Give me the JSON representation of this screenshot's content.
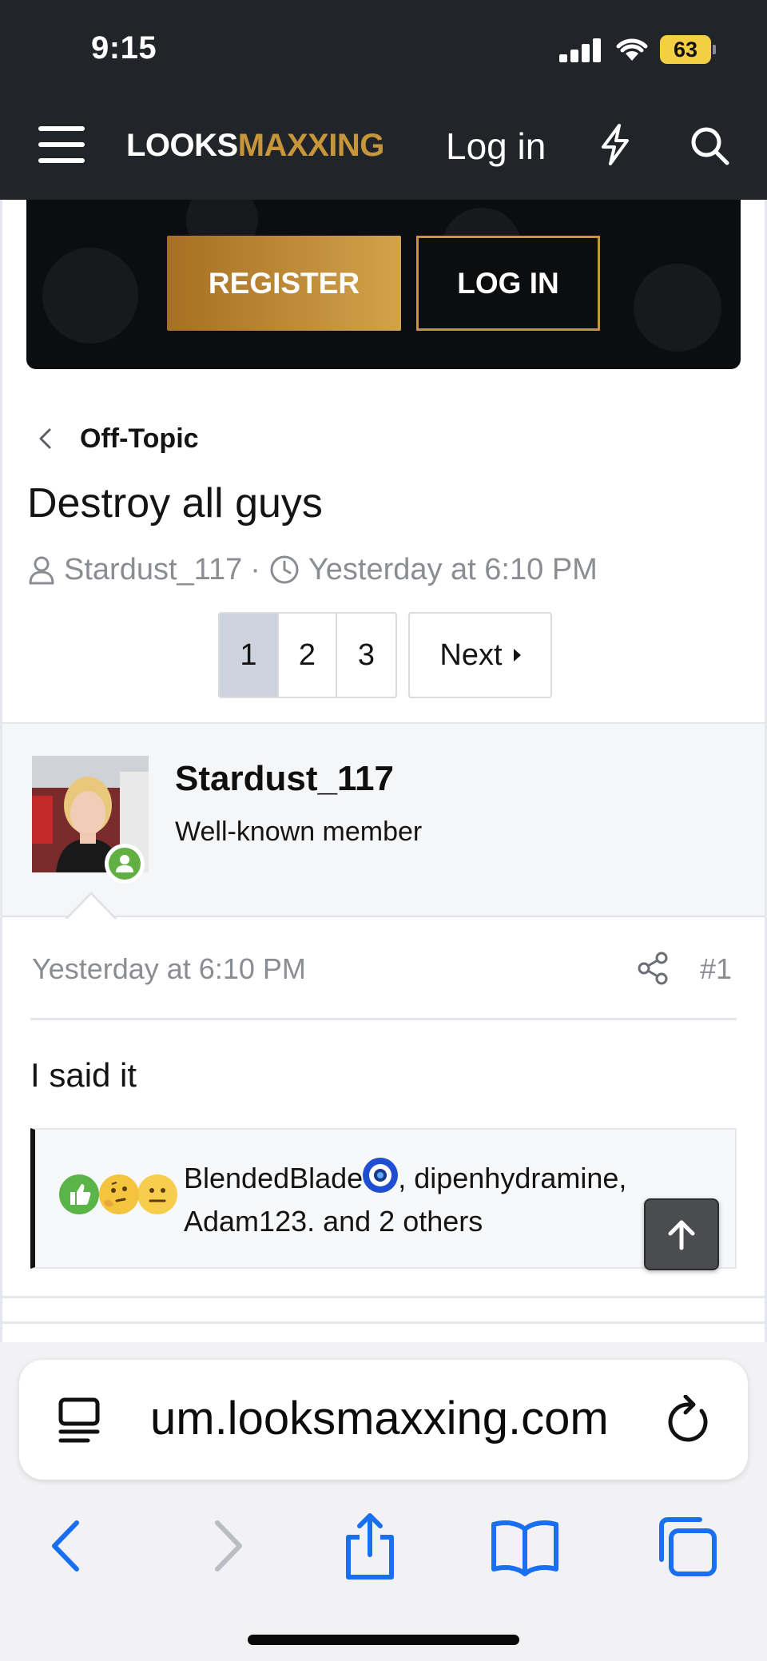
{
  "status_bar": {
    "time": "9:15",
    "battery": "63"
  },
  "header": {
    "logo_part1": "LOOKS",
    "logo_part2": "MAXXING",
    "login_label": "Log in"
  },
  "banner": {
    "register_label": "REGISTER",
    "login_label": "LOG IN"
  },
  "breadcrumb": {
    "label": "Off-Topic"
  },
  "thread": {
    "title": "Destroy all guys",
    "author": "Stardust_117",
    "separator": "·",
    "date": "Yesterday at 6:10 PM"
  },
  "pagination": {
    "pages": [
      "1",
      "2",
      "3"
    ],
    "current": "1",
    "next_label": "Next"
  },
  "post": {
    "username": "Stardust_117",
    "user_title": "Well-known member",
    "date": "Yesterday at 6:10 PM",
    "number": "#1",
    "body": "I said it",
    "reactions_line1_a": "BlendedBlade",
    "reactions_line1_b": ", dipenhydramine,",
    "reactions_line2": "Adam123. and 2 others"
  },
  "browser": {
    "url": "um.looksmaxxing.com"
  },
  "colors": {
    "brand_gold": "#c8963a",
    "header_bg": "#212428",
    "ios_blue": "#1a6ff0",
    "online_green": "#62b043"
  }
}
